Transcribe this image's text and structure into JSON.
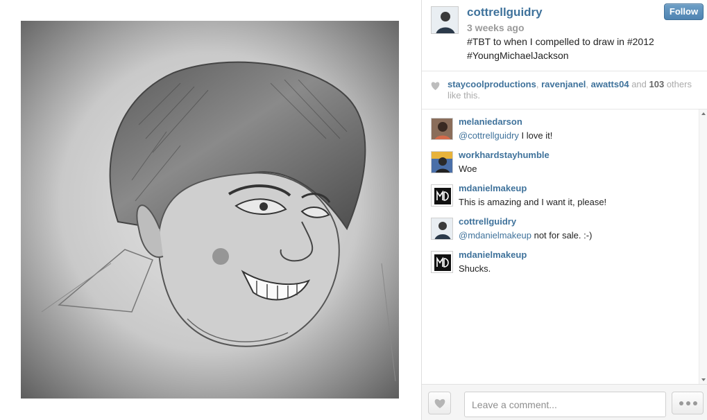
{
  "post": {
    "owner": {
      "username": "cottrellguidry",
      "avatar_icon": "user-avatar"
    },
    "time_ago": "3 weeks ago",
    "caption": "#TBT to when I compelled to draw in #2012 #YoungMichaelJackson",
    "follow_label": "Follow",
    "photo_description_icon": "pencil-portrait-image"
  },
  "likes": {
    "icon": "heart-icon",
    "users": [
      "staycoolproductions",
      "ravenjanel",
      "awatts04"
    ],
    "separator": ", ",
    "and_text": " and ",
    "count": "103",
    "others_text": " others like this."
  },
  "comments": [
    {
      "user": "melaniedarson",
      "mention": "@cottrellguidry",
      "text": " I love it!"
    },
    {
      "user": "workhardstayhumble",
      "mention": "",
      "text": "Woe"
    },
    {
      "user": "mdanielmakeup",
      "mention": "",
      "text": "This is amazing and I want it, please!"
    },
    {
      "user": "cottrellguidry",
      "mention": "@mdanielmakeup",
      "text": " not for sale. :-)"
    },
    {
      "user": "mdanielmakeup",
      "mention": "",
      "text": "Shucks."
    }
  ],
  "footer": {
    "comment_placeholder": "Leave a comment...",
    "like_icon": "heart-icon",
    "more_icon": "ellipsis-icon"
  },
  "colors": {
    "link": "#3f729b",
    "follow_button": "#4f84b2",
    "muted": "#9a9a9a"
  }
}
